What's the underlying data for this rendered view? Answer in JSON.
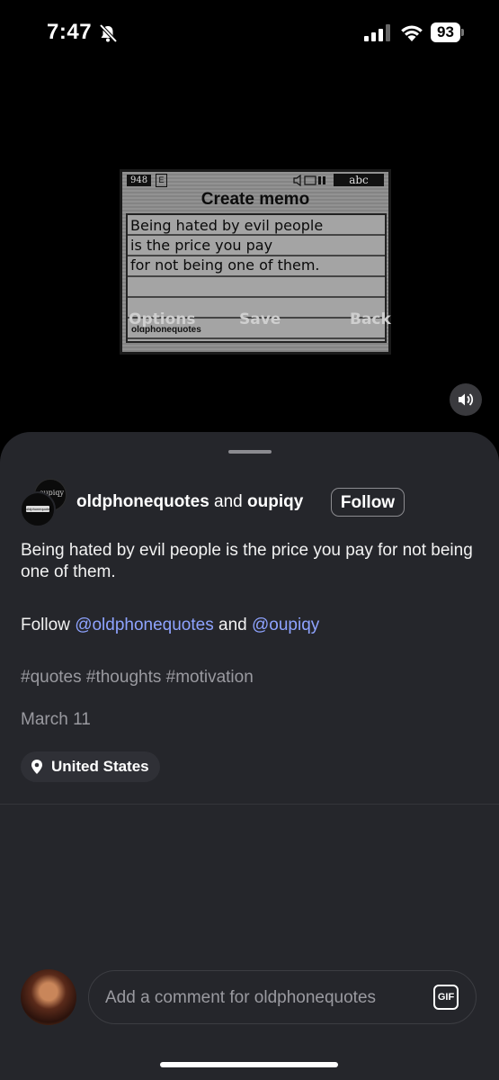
{
  "status_bar": {
    "time": "7:47",
    "battery": "93"
  },
  "video": {
    "phone_screen": {
      "counter": "948",
      "mode_icon": "E",
      "input_mode": "abc",
      "title": "Create memo",
      "lines": [
        "Being hated by evil people",
        "is the price you pay",
        "for not being one of them."
      ],
      "watermark": "oldphonequotes",
      "softkeys": {
        "left": "Options",
        "center": "Save",
        "right": "Back"
      }
    },
    "avatar_back_text": "oupiqy",
    "avatar_front_text": "oldphonequotes"
  },
  "post": {
    "author_primary": "oldphonequotes",
    "author_joiner": " and ",
    "author_secondary": "oupiqy",
    "follow_label": "Follow",
    "caption": "Being hated by evil people is the price you pay for not being one of them.",
    "follow_prefix": "Follow ",
    "mention_1": "@oldphonequotes",
    "mention_joiner": " and ",
    "mention_2": "@oupiqy",
    "hashtags": "#quotes #thoughts #motivation",
    "date": "March 11",
    "location": "United States"
  },
  "comment": {
    "placeholder": "Add a comment for oldphonequotes",
    "gif_label": "GIF"
  },
  "colors": {
    "sheet": "#25262b",
    "mention": "#8ea3ff",
    "muted_text": "#9a9aa0"
  }
}
